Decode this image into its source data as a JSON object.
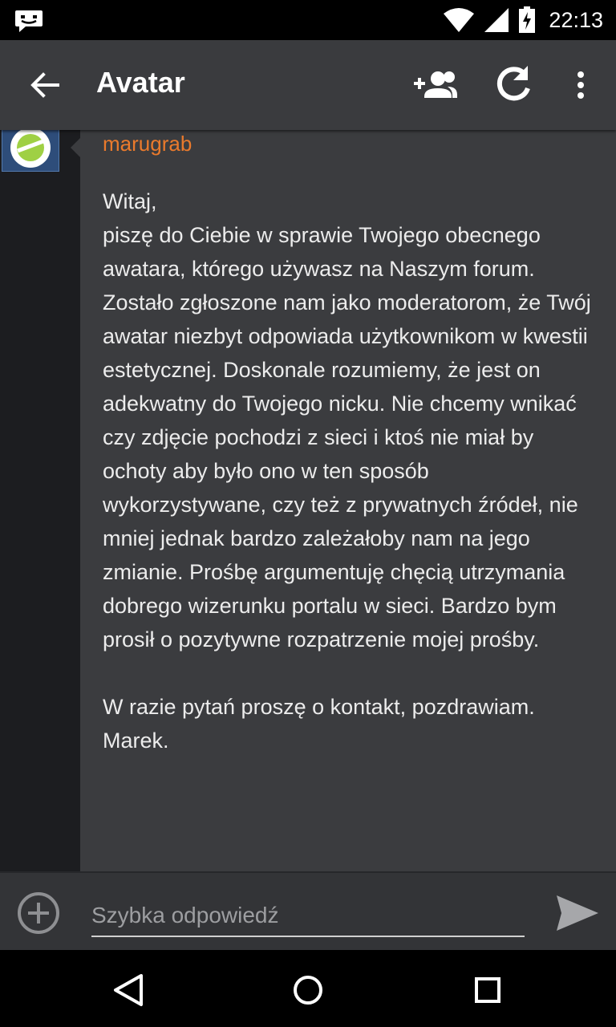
{
  "status_bar": {
    "time": "22:13",
    "icons": [
      "chat-notification-icon",
      "wifi-icon",
      "signal-icon",
      "battery-charging-icon"
    ]
  },
  "app_bar": {
    "title": "Avatar",
    "icons": [
      "back-arrow-icon",
      "add-user-icon",
      "refresh-icon",
      "more-vert-icon"
    ]
  },
  "message": {
    "author": "marugrab",
    "author_color": "#ea7a2c",
    "body": "Witaj,\npiszę do Ciebie w sprawie Twojego obecnego awatara, którego używasz na Naszym forum. Zostało zgłoszone nam jako moderatorom, że Twój awatar niezbyt odpowiada użytkownikom w kwestii estetycznej. Doskonale rozumiemy, że jest on adekwatny do Twojego nicku. Nie chcemy wnikać czy zdjęcie pochodzi z sieci i ktoś nie miał by ochoty aby było ono w ten sposób wykorzystywane, czy też z prywatnych źródeł, nie mniej jednak bardzo zależałoby nam na jego zmianie. Prośbę argumentuję chęcią utrzymania dobrego wizerunku portalu w sieci. Bardzo bym prosił o pozytywne rozpatrzenie mojej prośby.\n\nW razie pytań proszę o kontakt, pozdrawiam. Marek."
  },
  "reply_bar": {
    "placeholder": "Szybka odpowiedź",
    "icons": [
      "add-circle-icon",
      "send-icon"
    ]
  },
  "nav_bar": {
    "icons": [
      "nav-back-icon",
      "nav-home-icon",
      "nav-recents-icon"
    ]
  }
}
